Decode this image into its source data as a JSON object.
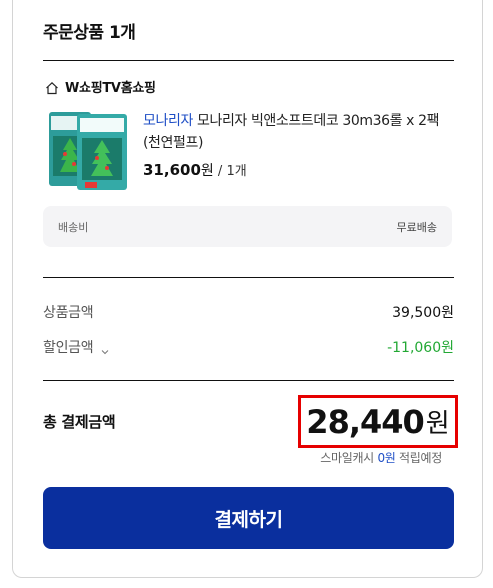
{
  "order": {
    "title": "주문상품 1개"
  },
  "shop": {
    "icon": "home-icon",
    "name": "W쇼핑TV홈쇼핑"
  },
  "product": {
    "brand": "모나리자",
    "name": "모나리자 빅앤소프트데코 30m36롤 x 2팩 (천연펄프)",
    "price": "31,600",
    "price_unit": "원",
    "separator": " / ",
    "quantity": "1개",
    "thumbnail_icon": "product-package-image"
  },
  "shipping": {
    "label": "배송비",
    "value": "무료배송"
  },
  "summary": {
    "product_amount_label": "상품금액",
    "product_amount_value": "39,500원",
    "discount_label": "할인금액",
    "discount_value": "-11,060원"
  },
  "total": {
    "label": "총 결제금액",
    "amount": "28,440",
    "unit": "원"
  },
  "points": {
    "prefix": "스마일캐시 ",
    "value": "0원",
    "suffix": " 적립예정"
  },
  "pay_button": {
    "label": "결제하기"
  },
  "colors": {
    "accent": "#0a2f9e",
    "brand_link": "#1f4fc6",
    "discount_green": "#22a834",
    "highlight_red": "#e60000"
  }
}
